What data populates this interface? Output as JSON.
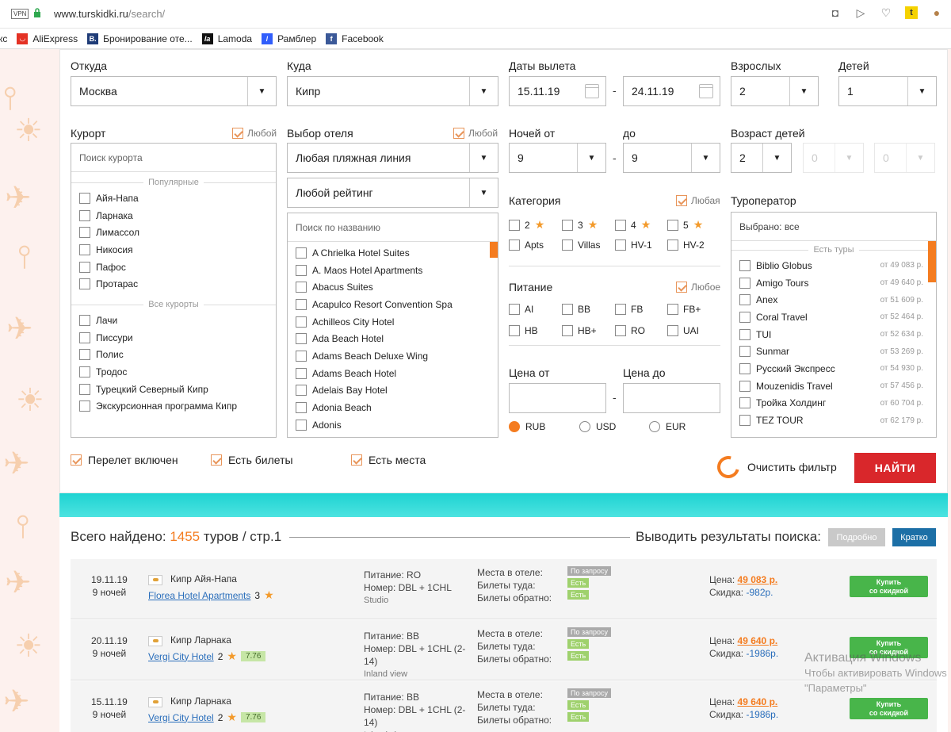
{
  "browser": {
    "vpn": "VPN",
    "url_host": "www.turskidki.ru",
    "url_path": "/search/",
    "bookmarks": [
      "кс",
      "AliExpress",
      "Бронирование оте...",
      "Lamoda",
      "Рамблер",
      "Facebook"
    ]
  },
  "filters": {
    "from_label": "Откуда",
    "from_value": "Москва",
    "to_label": "Куда",
    "to_value": "Кипр",
    "dates_label": "Даты вылета",
    "date_from": "15.11.19",
    "date_to": "24.11.19",
    "adults_label": "Взрослых",
    "adults_value": "2",
    "children_label": "Детей",
    "children_value": "1",
    "resort_label": "Курорт",
    "any_label": "Любой",
    "any_f_label": "Любая",
    "any_n_label": "Любое",
    "resort_placeholder": "Поиск курорта",
    "popular_group": "Популярные",
    "popular": [
      "Айя-Напа",
      "Ларнака",
      "Лимассол",
      "Никосия",
      "Пафос",
      "Протарас"
    ],
    "all_group": "Все курорты",
    "all_resorts": [
      "Лачи",
      "Писсури",
      "Полис",
      "Тродос",
      "Турецкий Северный Кипр",
      "Экскурсионная программа Кипр"
    ],
    "hotel_label": "Выбор отеля",
    "beach_line": "Любая пляжная линия",
    "rating": "Любой рейтинг",
    "hotel_search": "Поиск по названию",
    "hotels": [
      "A Chrielka Hotel Suites",
      "A. Maos Hotel Apartments",
      "Abacus Suites",
      "Acapulco Resort Convention Spa",
      "Achilleos City Hotel",
      "Ada Beach Hotel",
      "Adams Beach Deluxe Wing",
      "Adams Beach Hotel",
      "Adelais Bay Hotel",
      "Adonia Beach",
      "Adonis"
    ],
    "nights_from_label": "Ночей от",
    "nights_from": "9",
    "nights_to_label": "до",
    "nights_to": "9",
    "child_age_label": "Возраст детей",
    "child_age_1": "2",
    "child_age_2": "0",
    "child_age_3": "0",
    "category_label": "Категория",
    "categories": [
      "2",
      "3",
      "4",
      "5",
      "Apts",
      "Villas",
      "HV-1",
      "HV-2"
    ],
    "meal_label": "Питание",
    "meals": [
      "AI",
      "BB",
      "FB",
      "FB+",
      "HB",
      "HB+",
      "RO",
      "UAI"
    ],
    "price_from_label": "Цена от",
    "price_to_label": "Цена до",
    "currencies": [
      "RUB",
      "USD",
      "EUR"
    ],
    "operator_label": "Туроператор",
    "operator_selected": "Выбрано:  все",
    "operator_group": "Есть туры",
    "operators": [
      {
        "name": "Biblio Globus",
        "price": "от 49 083 р."
      },
      {
        "name": "Amigo Tours",
        "price": "от 49 640 р."
      },
      {
        "name": "Anex",
        "price": "от 51 609 р."
      },
      {
        "name": "Coral Travel",
        "price": "от 52 464 р."
      },
      {
        "name": "TUI",
        "price": "от 52 634 р."
      },
      {
        "name": "Sunmar",
        "price": "от 53 269 р."
      },
      {
        "name": "Русский Экспресс",
        "price": "от 54 930 р."
      },
      {
        "name": "Mouzenidis Travel",
        "price": "от 57 456 р."
      },
      {
        "name": "Тройка Холдинг",
        "price": "от 60 704 р."
      },
      {
        "name": "TEZ TOUR",
        "price": "от 62 179 р."
      }
    ],
    "flight_included": "Перелет включен",
    "tickets_avail": "Есть билеты",
    "seats_avail": "Есть места",
    "clear_filter": "Очистить фильтр",
    "find": "НАЙТИ"
  },
  "results": {
    "found_prefix": "Всего найдено: ",
    "found_count": "1455",
    "found_suffix": " туров / стр.1",
    "output_label": "Выводить результаты поиска:",
    "detailed": "Подробно",
    "brief": "Кратко",
    "meal_prefix": "Питание: ",
    "room_prefix": "Номер: ",
    "seats_hotel": "Места в отеле:",
    "tickets_there": "Билеты туда:",
    "tickets_back": "Билеты обратно:",
    "on_request": "По запросу",
    "yes": "Есть",
    "price_label": "Цена: ",
    "discount_label": "Скидка: ",
    "buy_line1": "Купить",
    "buy_line2": "со скидкой",
    "rows": [
      {
        "date": "19.11.19",
        "nights": "9 ночей",
        "location": "Кипр Айя-Напа",
        "hotel": "Florea Hotel Apartments",
        "stars": "3",
        "rating": "",
        "meal": "RO",
        "room": "DBL + 1CHL",
        "room_type": "Studio",
        "price": "49 083 р.",
        "discount": "-982р."
      },
      {
        "date": "20.11.19",
        "nights": "9 ночей",
        "location": "Кипр Ларнака",
        "hotel": "Vergi City Hotel",
        "stars": "2",
        "rating": "7.76",
        "meal": "BB",
        "room": "DBL + 1CHL (2-14)",
        "room_type": "Inland view",
        "price": "49 640 р.",
        "discount": "-1986р."
      },
      {
        "date": "15.11.19",
        "nights": "9 ночей",
        "location": "Кипр Ларнака",
        "hotel": "Vergi City Hotel",
        "stars": "2",
        "rating": "7.76",
        "meal": "BB",
        "room": "DBL + 1CHL (2-14)",
        "room_type": "Inland view",
        "price": "49 640 р.",
        "discount": "-1986р."
      }
    ]
  },
  "watermark": {
    "line1": "Активация Windows",
    "line2": "Чтобы активировать Windows",
    "line3": "\"Параметры\""
  },
  "colors": {
    "accent": "#f47c20",
    "find_button": "#d9272b",
    "buy_button": "#48b54a",
    "link": "#2a6ebb",
    "sea": "#1ed3d2"
  }
}
